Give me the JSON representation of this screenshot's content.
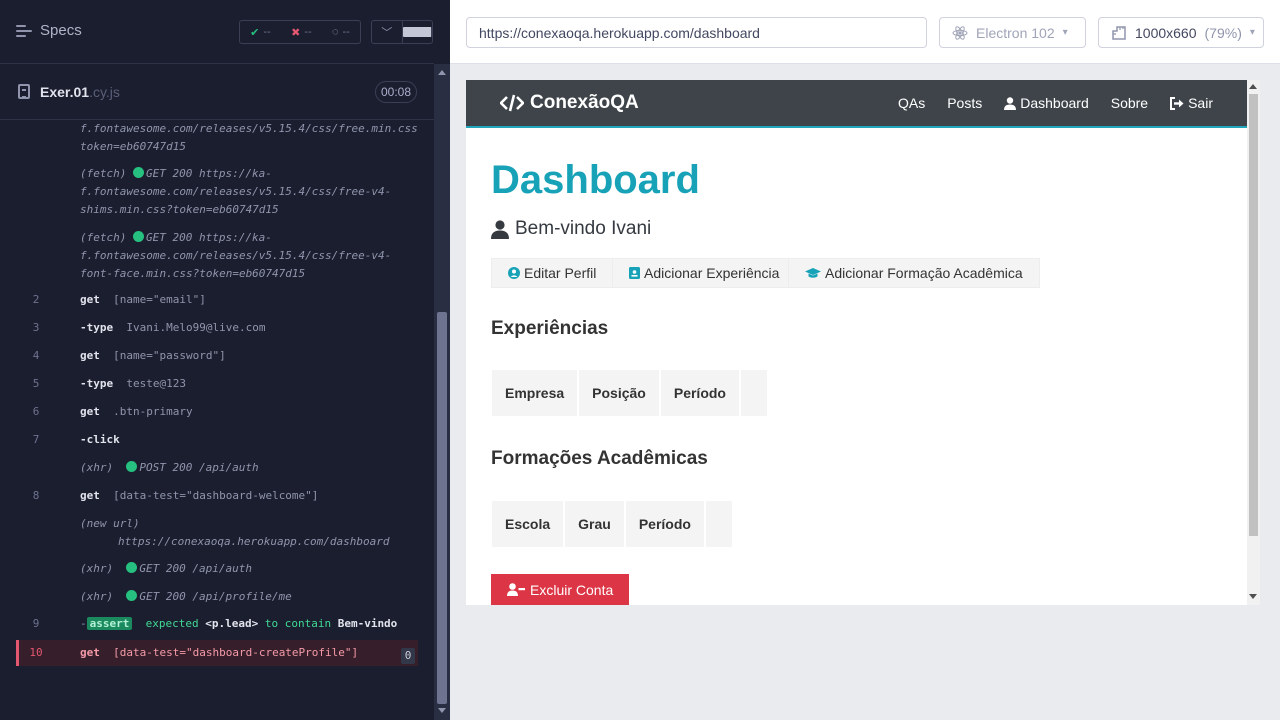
{
  "runner": {
    "specs_label": "Specs",
    "stats": {
      "passed": "--",
      "failed": "--",
      "pending": "--"
    },
    "file": {
      "name": "Exer.01",
      "ext": ".cy.js",
      "duration": "00:08"
    },
    "commands": [
      {
        "num": "",
        "kind": "url",
        "text": "f.fontawesome.com/releases/v5.15.4/css/free.min.css?token=eb60747d15"
      },
      {
        "num": "",
        "kind": "fetch",
        "prefix": "(fetch)",
        "method": "GET 200",
        "url": "https://ka-f.fontawesome.com/releases/v5.15.4/css/free-v4-shims.min.css?token=eb60747d15"
      },
      {
        "num": "",
        "kind": "fetch",
        "prefix": "(fetch)",
        "method": "GET 200",
        "url": "https://ka-f.fontawesome.com/releases/v5.15.4/css/free-v4-font-face.min.css?token=eb60747d15"
      },
      {
        "num": "2",
        "kind": "cmd",
        "name": "get",
        "arg": "[name=\"email\"]"
      },
      {
        "num": "3",
        "kind": "cmd",
        "name": "-type",
        "arg": "Ivani.Melo99@live.com"
      },
      {
        "num": "4",
        "kind": "cmd",
        "name": "get",
        "arg": "[name=\"password\"]"
      },
      {
        "num": "5",
        "kind": "cmd",
        "name": "-type",
        "arg": "teste@123"
      },
      {
        "num": "6",
        "kind": "cmd",
        "name": "get",
        "arg": ".btn-primary"
      },
      {
        "num": "7",
        "kind": "cmd",
        "name": "-click",
        "arg": ""
      },
      {
        "num": "",
        "kind": "xhr",
        "prefix": "(xhr)",
        "method": "POST 200",
        "url": "/api/auth"
      },
      {
        "num": "8",
        "kind": "cmd",
        "name": "get",
        "arg": "[data-test=\"dashboard-welcome\"]"
      },
      {
        "num": "",
        "kind": "newurl",
        "prefix": "(new url)",
        "url": "https://conexaoqa.herokuapp.com/dashboard"
      },
      {
        "num": "",
        "kind": "xhr",
        "prefix": "(xhr)",
        "method": "GET 200",
        "url": "/api/auth"
      },
      {
        "num": "",
        "kind": "xhr",
        "prefix": "(xhr)",
        "method": "GET 200",
        "url": "/api/profile/me"
      },
      {
        "num": "9",
        "kind": "assert",
        "badge": "assert",
        "word1": "expected",
        "subject": "<p.lead>",
        "word2": "to contain",
        "value": "Bem-vindo"
      },
      {
        "num": "10",
        "kind": "failed",
        "name": "get",
        "arg": "[data-test=\"dashboard-createProfile\"]",
        "count": "0"
      }
    ]
  },
  "aut": {
    "url": "https://conexaoqa.herokuapp.com/dashboard",
    "browser": "Electron 102",
    "viewport": "1000x660",
    "zoom": "(79%)"
  },
  "app": {
    "brand": "ConexãoQA",
    "nav": {
      "qas": "QAs",
      "posts": "Posts",
      "dashboard": "Dashboard",
      "sobre": "Sobre",
      "sair": "Sair"
    },
    "title": "Dashboard",
    "welcome": "Bem-vindo Ivani",
    "buttons": {
      "edit": "Editar Perfil",
      "add_exp": "Adicionar Experiência",
      "add_edu": "Adicionar Formação Acadêmica"
    },
    "experiences": {
      "heading": "Experiências",
      "columns": [
        "Empresa",
        "Posição",
        "Período",
        ""
      ]
    },
    "education": {
      "heading": "Formações Acadêmicas",
      "columns": [
        "Escola",
        "Grau",
        "Período",
        ""
      ]
    },
    "delete_label": "Excluir Conta"
  },
  "colors": {
    "accent": "#17a2b8",
    "danger": "#dc3545",
    "navbar": "#343a40",
    "runner_bg": "#1b1e2e",
    "pass": "#26c081",
    "fail": "#e45770"
  }
}
